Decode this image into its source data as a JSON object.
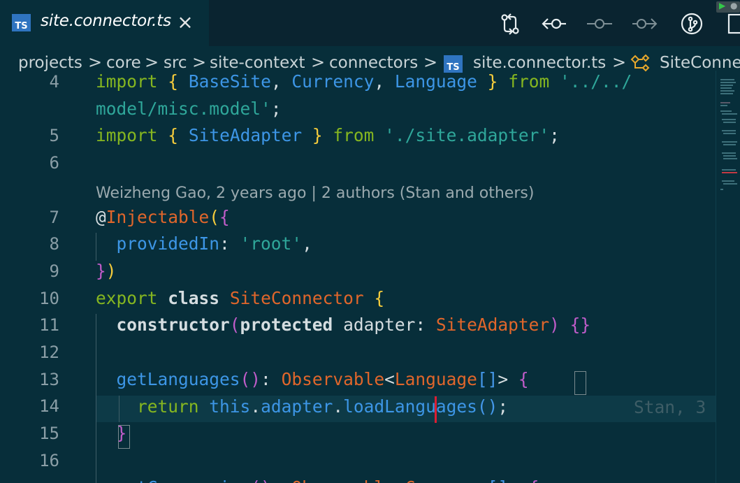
{
  "tab": {
    "icon_label": "TS",
    "title": "site.connector.ts",
    "close_glyph": "×"
  },
  "toolbar": {
    "buttons": [
      {
        "name": "compare-changes-icon"
      },
      {
        "name": "previous-revision-icon"
      },
      {
        "name": "current-revision-icon"
      },
      {
        "name": "next-revision-icon"
      },
      {
        "name": "source-control-icon"
      },
      {
        "name": "split-editor-icon"
      }
    ]
  },
  "breadcrumb": {
    "items": [
      "projects",
      "core",
      "src",
      "site-context",
      "connectors"
    ],
    "file_icon": "TS",
    "file": "site.connector.ts",
    "symbol": "SiteConne",
    "separator": ">"
  },
  "editor": {
    "line_numbers": [
      "4",
      "5",
      "6",
      "7",
      "8",
      "9",
      "10",
      "11",
      "12",
      "13",
      "14",
      "15",
      "16"
    ],
    "codelens": "Weizheng Gao, 2 years ago | 2 authors (Stan and others)",
    "inline_blame": "Stan, 3",
    "accent_colors": {
      "keyword": "#85b620",
      "class": "#e0662b",
      "identifier": "#3d96e6",
      "string": "#2fa79a",
      "bracket": "#f5cc3c",
      "cursor": "#dc1e33"
    }
  }
}
